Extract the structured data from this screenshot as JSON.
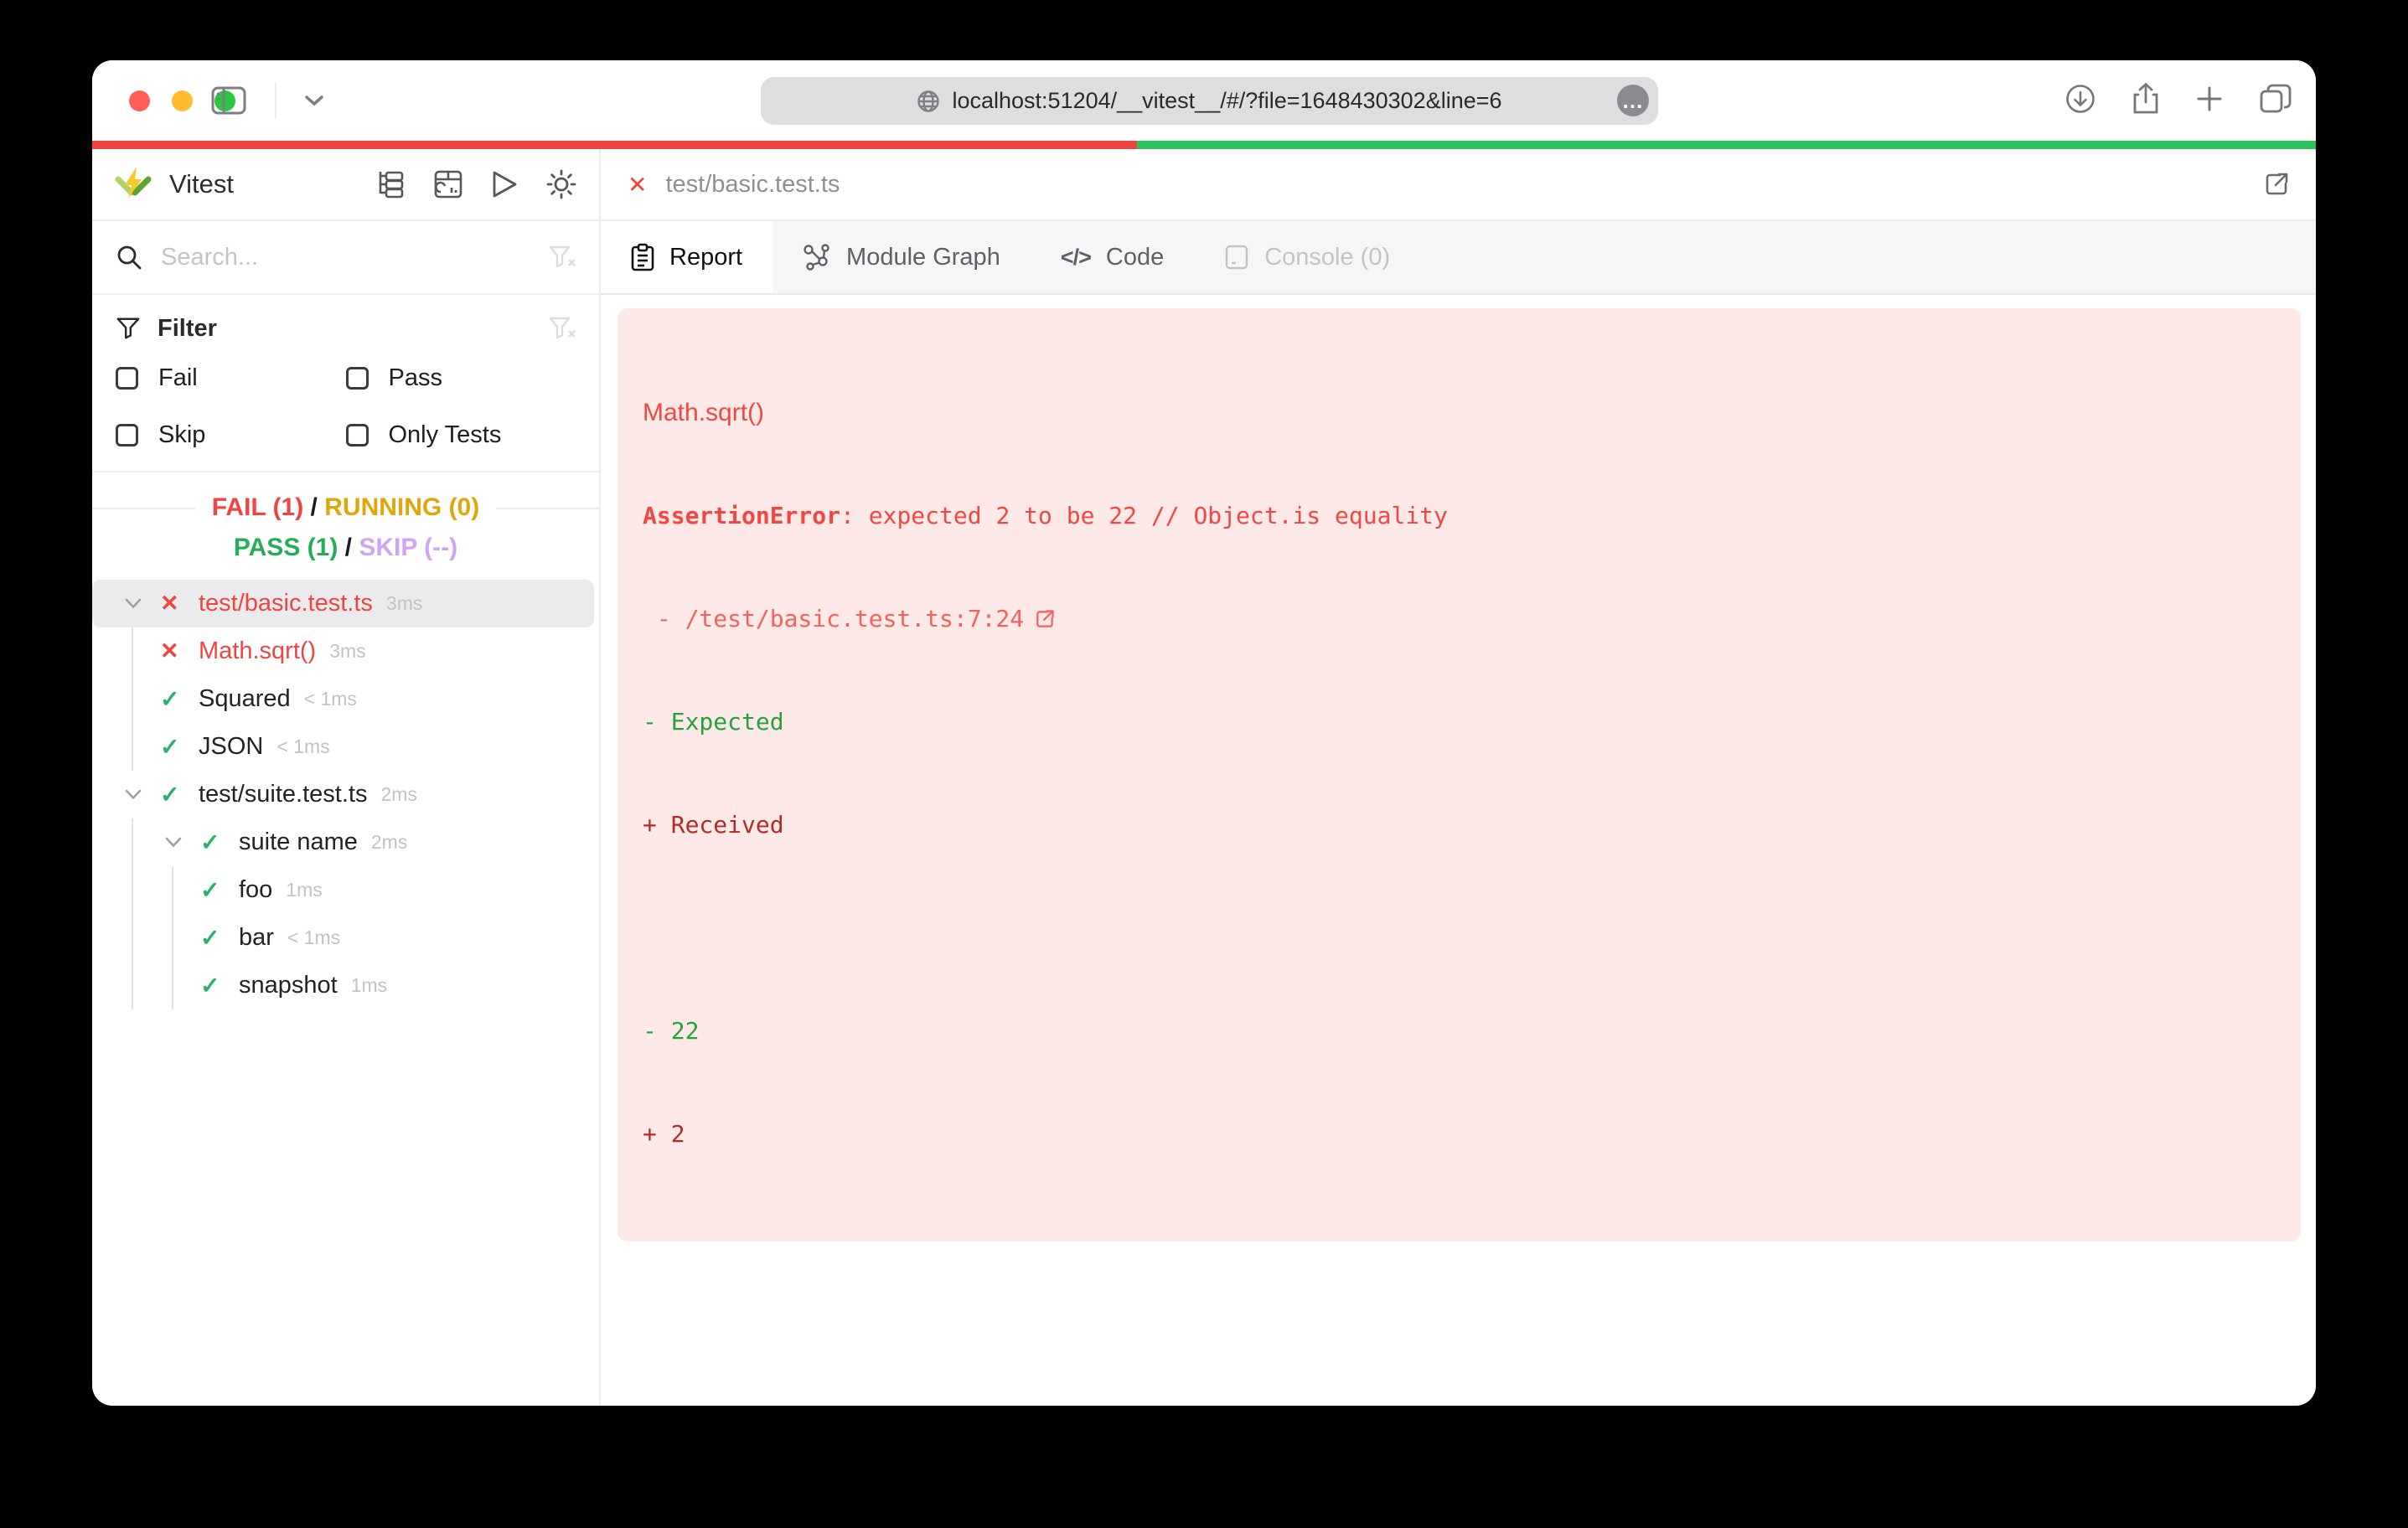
{
  "browser": {
    "url": "localhost:51204/__vitest__/#/?file=1648430302&line=6",
    "ellipsis_glyph": "•••",
    "icons": [
      "sidebar-toggle-icon",
      "chevron-down-icon",
      "globe-icon",
      "page-menu-icon",
      "download-icon",
      "share-icon",
      "new-tab-icon",
      "tab-overview-icon"
    ]
  },
  "progress": {
    "fail_fraction": 0.47,
    "fail_color": "#f04440",
    "pass_color": "#2cc35f"
  },
  "app": {
    "title": "Vitest",
    "header_icons": [
      "toggle-tree-icon",
      "dashboard-icon",
      "run-all-icon",
      "theme-toggle-icon"
    ],
    "file_tab": {
      "close_glyph": "✕",
      "label": "test/basic.test.ts"
    },
    "tabs": [
      {
        "label": "Report",
        "state": "active",
        "icon": "report-icon"
      },
      {
        "label": "Module Graph",
        "state": "normal",
        "icon": "module-graph-icon"
      },
      {
        "label": "Code",
        "state": "normal",
        "icon": "code-icon",
        "glyph": "</>"
      },
      {
        "label": "Console (0)",
        "state": "disabled",
        "icon": "console-icon"
      }
    ]
  },
  "sidebar": {
    "search": {
      "placeholder": "Search...",
      "icon": "search-icon",
      "clear_icon": "filter-clear-icon"
    },
    "filter": {
      "title": "Filter",
      "icon": "funnel-icon",
      "clear_icon": "filter-clear-icon",
      "options": [
        {
          "label": "Fail",
          "checked": false
        },
        {
          "label": "Pass",
          "checked": false
        },
        {
          "label": "Skip",
          "checked": false
        },
        {
          "label": "Only Tests",
          "checked": false
        }
      ]
    },
    "summary": {
      "fail": "FAIL (1)",
      "running": "RUNNING (0)",
      "pass": "PASS (1)",
      "skip": "SKIP (--)",
      "separator": " / ",
      "colors": {
        "fail": "#f04444",
        "running": "#dfa60d",
        "pass": "#26ad58",
        "skip": "#cfa4f2"
      }
    },
    "tree": [
      {
        "label": "test/basic.test.ts",
        "time": "3ms",
        "status": "fail",
        "depth": 0,
        "expandable": true,
        "selected": true
      },
      {
        "label": "Math.sqrt()",
        "time": "3ms",
        "status": "fail",
        "depth": 1,
        "expandable": false,
        "selected": false
      },
      {
        "label": "Squared",
        "time": "< 1ms",
        "status": "pass",
        "depth": 1,
        "expandable": false,
        "selected": false
      },
      {
        "label": "JSON",
        "time": "< 1ms",
        "status": "pass",
        "depth": 1,
        "expandable": false,
        "selected": false
      },
      {
        "label": "test/suite.test.ts",
        "time": "2ms",
        "status": "pass",
        "depth": 0,
        "expandable": true,
        "selected": false
      },
      {
        "label": "suite name",
        "time": "2ms",
        "status": "pass",
        "depth": 1,
        "expandable": true,
        "selected": false
      },
      {
        "label": "foo",
        "time": "1ms",
        "status": "pass",
        "depth": 2,
        "expandable": false,
        "selected": false
      },
      {
        "label": "bar",
        "time": "< 1ms",
        "status": "pass",
        "depth": 2,
        "expandable": false,
        "selected": false
      },
      {
        "label": "snapshot",
        "time": "1ms",
        "status": "pass",
        "depth": 2,
        "expandable": false,
        "selected": false
      }
    ],
    "status_glyphs": {
      "fail": "✕",
      "pass": "✓"
    }
  },
  "error_report": {
    "background": "#fce9e8",
    "test_name": "Math.sqrt()",
    "error_name": "AssertionError",
    "error_message": ": expected 2 to be 22 // Object.is equality",
    "location": " - /test/basic.test.ts:7:24",
    "diff": [
      {
        "text": "- Expected",
        "kind": "expected"
      },
      {
        "text": "+ Received",
        "kind": "received"
      },
      {
        "text": "",
        "kind": "blank"
      },
      {
        "text": "- 22",
        "kind": "expected"
      },
      {
        "text": "+ 2",
        "kind": "received"
      }
    ]
  }
}
